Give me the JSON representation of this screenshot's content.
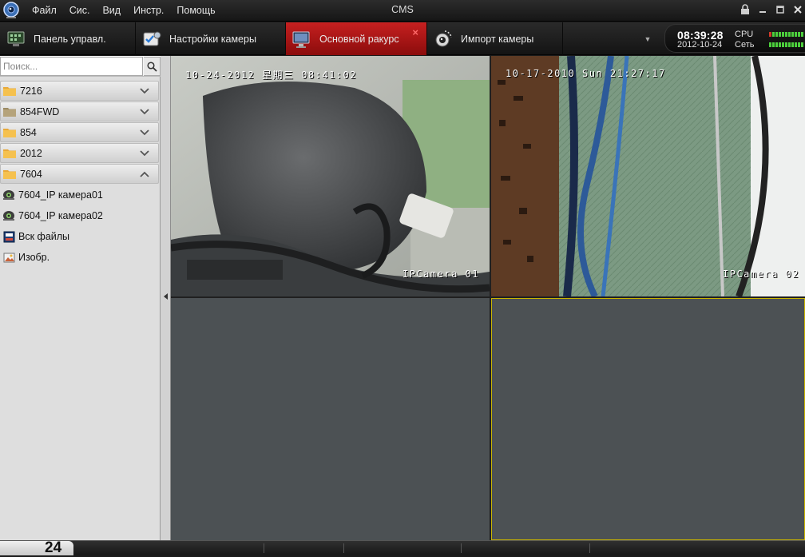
{
  "app": {
    "title": "CMS"
  },
  "menu": [
    "Файл",
    "Сис.",
    "Вид",
    "Инстр.",
    "Помощь"
  ],
  "tabs": [
    {
      "label": "Панель управл.",
      "icon": "control-panel-icon",
      "active": false
    },
    {
      "label": "Настройки камеры",
      "icon": "camera-settings-icon",
      "active": false
    },
    {
      "label": "Основной ракурс",
      "icon": "monitor-icon",
      "active": true
    },
    {
      "label": "Импорт камеры",
      "icon": "camera-import-icon",
      "active": false
    }
  ],
  "status": {
    "time": "08:39:28",
    "date": "2012-10-24",
    "cpu_label": "CPU",
    "net_label": "Сеть"
  },
  "search": {
    "placeholder": "Поиск..."
  },
  "tree": {
    "groups": [
      {
        "label": "7216",
        "expanded": false
      },
      {
        "label": "854FWD",
        "expanded": false
      },
      {
        "label": "854",
        "expanded": false
      },
      {
        "label": "2012",
        "expanded": false
      },
      {
        "label": "7604",
        "expanded": true
      }
    ],
    "items": [
      {
        "label": "7604_IP камера01",
        "icon": "ip-camera-icon"
      },
      {
        "label": "7604_IP камера02",
        "icon": "ip-camera-icon"
      },
      {
        "label": "Вск файлы",
        "icon": "all-files-icon"
      },
      {
        "label": "Изобр.",
        "icon": "image-icon"
      }
    ]
  },
  "cameras": [
    {
      "timestamp": "10-24-2012 星期三 08:41:02",
      "name": "IPCamera 01"
    },
    {
      "timestamp": "10-17-2010 Sun 21:27:17",
      "name": "IPCamera 02"
    }
  ],
  "bottom": {
    "number": "24"
  },
  "colors": {
    "active_tab": "#b31616",
    "selected_cell_border": "#c9b500",
    "empty_cell": "#4c5154"
  }
}
